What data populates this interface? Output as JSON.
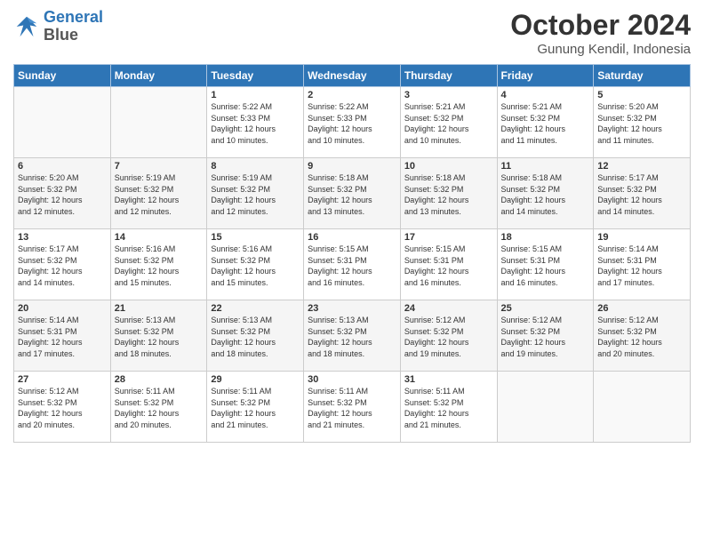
{
  "header": {
    "logo_line1": "General",
    "logo_line2": "Blue",
    "month": "October 2024",
    "location": "Gunung Kendil, Indonesia"
  },
  "weekdays": [
    "Sunday",
    "Monday",
    "Tuesday",
    "Wednesday",
    "Thursday",
    "Friday",
    "Saturday"
  ],
  "weeks": [
    [
      {
        "day": "",
        "text": ""
      },
      {
        "day": "",
        "text": ""
      },
      {
        "day": "1",
        "text": "Sunrise: 5:22 AM\nSunset: 5:33 PM\nDaylight: 12 hours\nand 10 minutes."
      },
      {
        "day": "2",
        "text": "Sunrise: 5:22 AM\nSunset: 5:33 PM\nDaylight: 12 hours\nand 10 minutes."
      },
      {
        "day": "3",
        "text": "Sunrise: 5:21 AM\nSunset: 5:32 PM\nDaylight: 12 hours\nand 10 minutes."
      },
      {
        "day": "4",
        "text": "Sunrise: 5:21 AM\nSunset: 5:32 PM\nDaylight: 12 hours\nand 11 minutes."
      },
      {
        "day": "5",
        "text": "Sunrise: 5:20 AM\nSunset: 5:32 PM\nDaylight: 12 hours\nand 11 minutes."
      }
    ],
    [
      {
        "day": "6",
        "text": "Sunrise: 5:20 AM\nSunset: 5:32 PM\nDaylight: 12 hours\nand 12 minutes."
      },
      {
        "day": "7",
        "text": "Sunrise: 5:19 AM\nSunset: 5:32 PM\nDaylight: 12 hours\nand 12 minutes."
      },
      {
        "day": "8",
        "text": "Sunrise: 5:19 AM\nSunset: 5:32 PM\nDaylight: 12 hours\nand 12 minutes."
      },
      {
        "day": "9",
        "text": "Sunrise: 5:18 AM\nSunset: 5:32 PM\nDaylight: 12 hours\nand 13 minutes."
      },
      {
        "day": "10",
        "text": "Sunrise: 5:18 AM\nSunset: 5:32 PM\nDaylight: 12 hours\nand 13 minutes."
      },
      {
        "day": "11",
        "text": "Sunrise: 5:18 AM\nSunset: 5:32 PM\nDaylight: 12 hours\nand 14 minutes."
      },
      {
        "day": "12",
        "text": "Sunrise: 5:17 AM\nSunset: 5:32 PM\nDaylight: 12 hours\nand 14 minutes."
      }
    ],
    [
      {
        "day": "13",
        "text": "Sunrise: 5:17 AM\nSunset: 5:32 PM\nDaylight: 12 hours\nand 14 minutes."
      },
      {
        "day": "14",
        "text": "Sunrise: 5:16 AM\nSunset: 5:32 PM\nDaylight: 12 hours\nand 15 minutes."
      },
      {
        "day": "15",
        "text": "Sunrise: 5:16 AM\nSunset: 5:32 PM\nDaylight: 12 hours\nand 15 minutes."
      },
      {
        "day": "16",
        "text": "Sunrise: 5:15 AM\nSunset: 5:31 PM\nDaylight: 12 hours\nand 16 minutes."
      },
      {
        "day": "17",
        "text": "Sunrise: 5:15 AM\nSunset: 5:31 PM\nDaylight: 12 hours\nand 16 minutes."
      },
      {
        "day": "18",
        "text": "Sunrise: 5:15 AM\nSunset: 5:31 PM\nDaylight: 12 hours\nand 16 minutes."
      },
      {
        "day": "19",
        "text": "Sunrise: 5:14 AM\nSunset: 5:31 PM\nDaylight: 12 hours\nand 17 minutes."
      }
    ],
    [
      {
        "day": "20",
        "text": "Sunrise: 5:14 AM\nSunset: 5:31 PM\nDaylight: 12 hours\nand 17 minutes."
      },
      {
        "day": "21",
        "text": "Sunrise: 5:13 AM\nSunset: 5:32 PM\nDaylight: 12 hours\nand 18 minutes."
      },
      {
        "day": "22",
        "text": "Sunrise: 5:13 AM\nSunset: 5:32 PM\nDaylight: 12 hours\nand 18 minutes."
      },
      {
        "day": "23",
        "text": "Sunrise: 5:13 AM\nSunset: 5:32 PM\nDaylight: 12 hours\nand 18 minutes."
      },
      {
        "day": "24",
        "text": "Sunrise: 5:12 AM\nSunset: 5:32 PM\nDaylight: 12 hours\nand 19 minutes."
      },
      {
        "day": "25",
        "text": "Sunrise: 5:12 AM\nSunset: 5:32 PM\nDaylight: 12 hours\nand 19 minutes."
      },
      {
        "day": "26",
        "text": "Sunrise: 5:12 AM\nSunset: 5:32 PM\nDaylight: 12 hours\nand 20 minutes."
      }
    ],
    [
      {
        "day": "27",
        "text": "Sunrise: 5:12 AM\nSunset: 5:32 PM\nDaylight: 12 hours\nand 20 minutes."
      },
      {
        "day": "28",
        "text": "Sunrise: 5:11 AM\nSunset: 5:32 PM\nDaylight: 12 hours\nand 20 minutes."
      },
      {
        "day": "29",
        "text": "Sunrise: 5:11 AM\nSunset: 5:32 PM\nDaylight: 12 hours\nand 21 minutes."
      },
      {
        "day": "30",
        "text": "Sunrise: 5:11 AM\nSunset: 5:32 PM\nDaylight: 12 hours\nand 21 minutes."
      },
      {
        "day": "31",
        "text": "Sunrise: 5:11 AM\nSunset: 5:32 PM\nDaylight: 12 hours\nand 21 minutes."
      },
      {
        "day": "",
        "text": ""
      },
      {
        "day": "",
        "text": ""
      }
    ]
  ]
}
